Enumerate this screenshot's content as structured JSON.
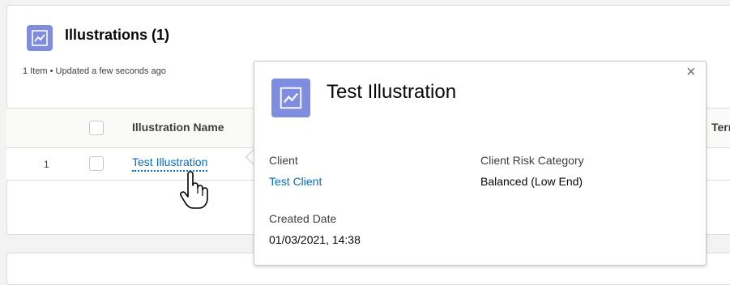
{
  "list": {
    "title": "Illustrations (1)",
    "subtitle": "1 Item • Updated a few seconds ago",
    "columns": [
      "Illustration Name",
      "Term"
    ],
    "rows": [
      {
        "num": "1",
        "name": "Test Illustration"
      }
    ]
  },
  "popover": {
    "title": "Test Illustration",
    "close_glyph": "×",
    "fields": {
      "client_label": "Client",
      "client_value": "Test Client",
      "risk_label": "Client Risk Category",
      "risk_value": "Balanced (Low End)",
      "created_label": "Created Date",
      "created_value": "01/03/2021, 14:38"
    }
  },
  "colors": {
    "icon_bg": "#7f8de1",
    "link": "#006dcc"
  },
  "icons": {
    "object": "chart-line-icon",
    "cursor": "hand-pointer-icon",
    "close": "close-icon"
  }
}
